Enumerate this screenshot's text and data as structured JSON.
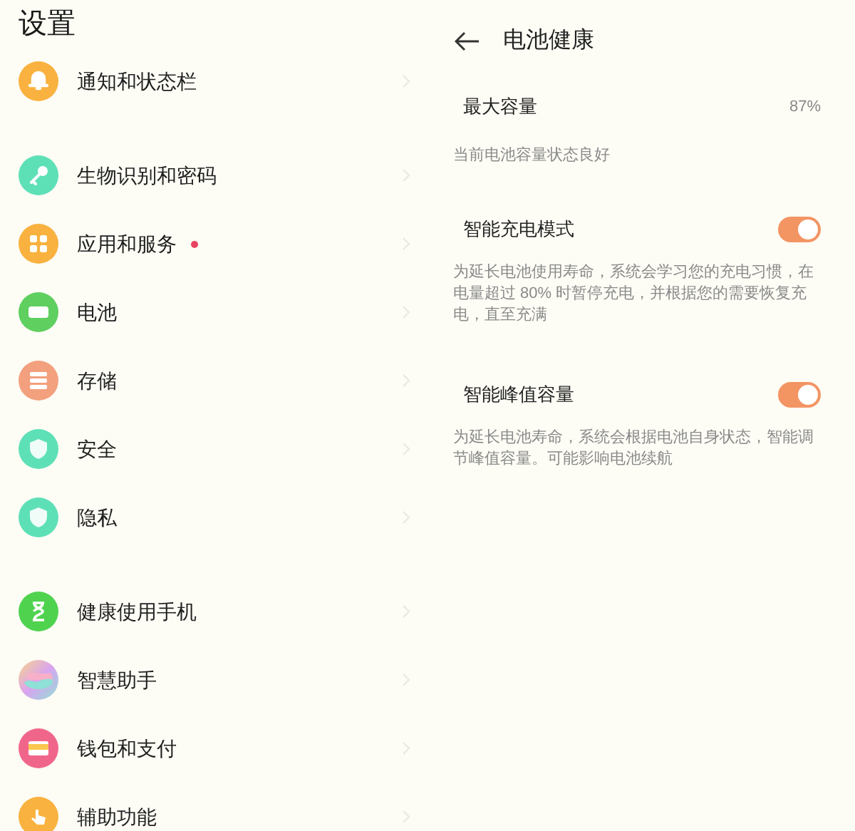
{
  "settings": {
    "title": "设置",
    "groups": [
      {
        "items": [
          {
            "label": "通知和状态栏",
            "color": "#f9b23f",
            "badge": false
          }
        ]
      },
      {
        "items": [
          {
            "label": "生物识别和密码",
            "color": "#5ee0b7",
            "badge": false
          },
          {
            "label": "应用和服务",
            "color": "#f9b23f",
            "badge": true
          },
          {
            "label": "电池",
            "color": "#5fcf5f",
            "badge": false
          },
          {
            "label": "存储",
            "color": "#f3a07e",
            "badge": false
          },
          {
            "label": "安全",
            "color": "#5ee0b7",
            "badge": false
          },
          {
            "label": "隐私",
            "color": "#5ee0b7",
            "badge": false
          }
        ]
      },
      {
        "items": [
          {
            "label": "健康使用手机",
            "color": "#4fd34f",
            "badge": false
          },
          {
            "label": "智慧助手",
            "badge": false
          },
          {
            "label": "钱包和支付",
            "color": "#f0668a",
            "badge": false
          },
          {
            "label": "辅助功能",
            "color": "#f9b23f",
            "badge": false
          }
        ]
      }
    ]
  },
  "battery_health": {
    "title": "电池健康",
    "max_capacity": {
      "label": "最大容量",
      "value": "87%",
      "note": "当前电池容量状态良好"
    },
    "options": [
      {
        "label": "智能充电模式",
        "on": true,
        "description": "为延长电池使用寿命，系统会学习您的充电习惯，在电量超过 80% 时暂停充电，并根据您的需要恢复充电，直至充满"
      },
      {
        "label": "智能峰值容量",
        "on": true,
        "description": "为延长电池寿命，系统会根据电池自身状态，智能调节峰值容量。可能影响电池续航"
      }
    ]
  }
}
